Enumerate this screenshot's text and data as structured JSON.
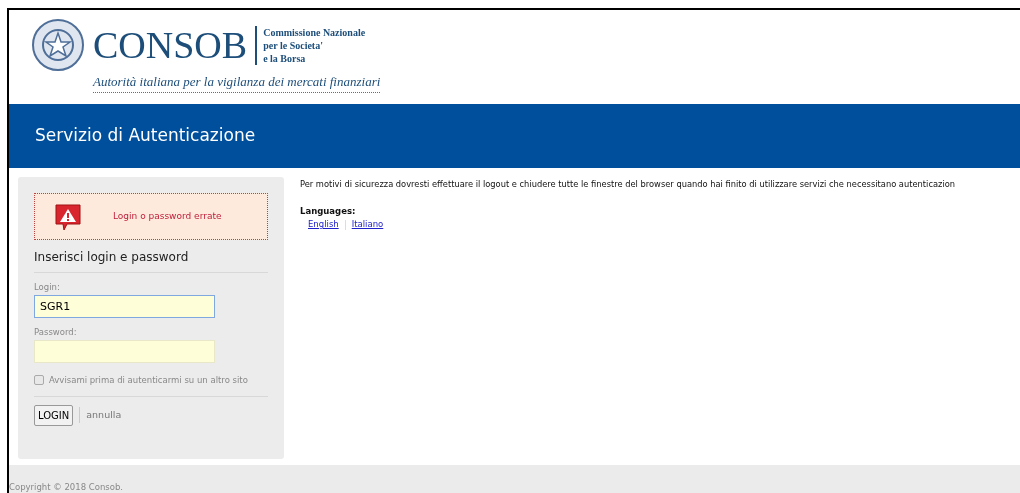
{
  "logo": {
    "wordmark": "CONSOB",
    "org_line_1": "Commissione Nazionale",
    "org_line_2": "per le Societa'",
    "org_line_3": "e la Borsa",
    "tagline": "Autorità italiana per la vigilanza dei mercati finanziari"
  },
  "banner": {
    "title": "Servizio di Autenticazione"
  },
  "login": {
    "error": "Login o password errate",
    "heading": "Inserisci login e password",
    "fields": [
      {
        "label": "Login:",
        "value": "SGR1",
        "focused": true
      },
      {
        "label": "Password:",
        "focused": false
      }
    ],
    "warn_checkbox": {
      "label": "Avvisami prima di autenticarmi su un altro sito",
      "checked": false
    },
    "submit": "LOGIN",
    "cancel": "annulla"
  },
  "notice": "Per motivi di sicurezza dovresti effettuare il logout e chiudere tutte le finestre del browser quando hai finito di utilizzare servizi che necessitano autenticazion",
  "languages": {
    "title": "Languages:",
    "links": [
      "English",
      "Italiano"
    ]
  },
  "footer": "Copyright © 2018 Consob."
}
